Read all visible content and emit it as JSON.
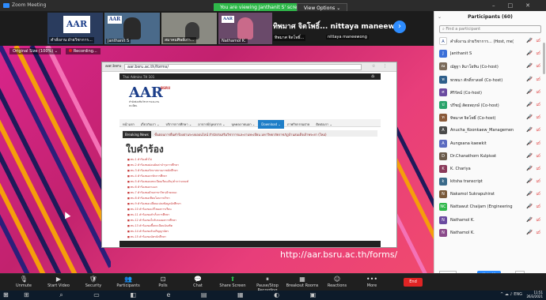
{
  "window": {
    "title": "Zoom Meeting"
  },
  "share_banner": "You are viewing Janthanit S' screen",
  "view_options": "View Options ⌄",
  "thumbnails": [
    {
      "name": "คำสั่งงาน ฝ่ายวิชาการ..."
    },
    {
      "name": "Janthanit S"
    },
    {
      "name": "สมาคมศิษย์เก่า..."
    },
    {
      "name": "Nathamol K."
    },
    {
      "name": "ทิพมาศ จิตโพธิ์..."
    },
    {
      "name": "nittaya maneewong"
    }
  ],
  "presenter_text": "ทิพมาศ จิตโพธิ์... nittaya maneew...",
  "share_toolbar": {
    "original_size": "Original Size (100%) ⌄",
    "recording": "Recording..."
  },
  "browser": {
    "tab": "aar.bsru",
    "url": "aar.bsru.ac.th/forms/"
  },
  "site": {
    "topbar": "Thai Admins TH 101",
    "logo": {
      "main": "AAR",
      "badge": "BSRU",
      "sub": "สำนักส่งเสริมวิชาการและงานทะเบียน"
    },
    "nav": [
      "หน้าแรก",
      "เกี่ยวกับเรา ⌄",
      "บริการการศึกษา ⌄",
      "อาจารย์/บุคลากร ⌄",
      "บุคคลภายนอก ⌄",
      "Download ⌄",
      "ภาพกิจกรรมฝ่าย",
      "ติดต่อเรา ⌄"
    ],
    "ticker_label": "Breaking News",
    "ticker_text": "ขั้นตอนการยื่นคำร้องผ่านระบบออนไลน์ สำนักส่งเสริมวิชาการและงานทะเบียน มหาวิทยาลัยราชภัฏบ้านสมเด็จเจ้าพระยา (ใหม่)",
    "heading": "ใบคำร้อง",
    "forms": [
      "ทบ.1 คำร้องทั่วไป",
      "ทบ.2 คำร้องขอผ่อนผันค่าบำรุงการศึกษา",
      "ทบ.3 คำร้องขอรักษาสถานภาพนักศึกษา",
      "ทบ.4 คำร้องขอลาพักการศึกษา",
      "ทบ.5 คำร้องขอลงทะเบียนเรียนเกิน/ต่ำกว่าเกณฑ์",
      "ทบ.6 คำร้องขอลาออก",
      "ทบ.7 คำร้องขอย้ายสาขาวิชา/ย้ายคณะ",
      "ทบ.8 คำร้องขอเทียบโอนรายวิชา",
      "ทบ.9 คำร้องขอเปลี่ยนแปลงข้อมูลนักศึกษา",
      "ทบ.10 คำร้องขอแก้ไขผลการเรียน",
      "ทบ.11 คำร้องขอสำเร็จการศึกษา",
      "ทบ.12 คำร้องขอใบรับรองผลการศึกษา",
      "ทบ.13 คำร้องขอขึ้นทะเบียนบัณฑิต",
      "ทบ.14 คำร้องขอรับปริญญาบัตร",
      "ทบ.15 คำร้องขอบัตรนักศึกษา",
      "ทบ.16 คำร้องขอคืนเงินค่าธรรมเนียม",
      "ทบ.17 คำร้องขอลงทะเบียนเรียนเพิ่ม/ถอน"
    ]
  },
  "url_caption": "http://aar.bsru.ac.th/forms/",
  "toolbar": [
    {
      "name": "unmute",
      "label": "Unmute",
      "icon": "🎙"
    },
    {
      "name": "start-video",
      "label": "Start Video",
      "icon": "▶"
    },
    {
      "name": "security",
      "label": "Security",
      "icon": "🛡"
    },
    {
      "name": "participants",
      "label": "Participants",
      "icon": "👥"
    },
    {
      "name": "polls",
      "label": "Polls",
      "icon": "⊡"
    },
    {
      "name": "chat",
      "label": "Chat",
      "icon": "💬"
    },
    {
      "name": "share-screen",
      "label": "Share Screen",
      "icon": "⬆"
    },
    {
      "name": "pause-recording",
      "label": "Pause/Stop Recording",
      "icon": "⏸"
    },
    {
      "name": "breakout-rooms",
      "label": "Breakout Rooms",
      "icon": "▦"
    },
    {
      "name": "reactions",
      "label": "Reactions",
      "icon": "☺"
    },
    {
      "name": "more",
      "label": "More",
      "icon": "•••"
    }
  ],
  "end_label": "End",
  "participants_panel": {
    "title": "Participants (60)",
    "search_placeholder": "Find a participant",
    "people": [
      {
        "name": "คำสั่งงาน ฝ่ายวิชาการ... (Host, me)",
        "initial": "A",
        "color": "#ffffff"
      },
      {
        "name": "Janthanit S",
        "initial": "J",
        "color": "#3b6fd8"
      },
      {
        "name": "ณัฐฐา ลิมาโยทิน (Co-host)",
        "initial": "ณ",
        "color": "#7a6a5a"
      },
      {
        "name": "พรพนา ศักดิ์ทาสงค์ (Co-host)",
        "initial": "พ",
        "color": "#2f5f8a"
      },
      {
        "name": "ศิริรัตน์ (Co-host)",
        "initial": "ศ",
        "color": "#6a4aa0"
      },
      {
        "name": "ปรีชญ์ สัตยพฤกษ์ (Co-host)",
        "initial": "ป",
        "color": "#2aa36b"
      },
      {
        "name": "ทิพมาศ จิตโพธิ์ (Co-host)",
        "initial": "ท",
        "color": "#8a5a3a"
      },
      {
        "name": "Anucha_Koonkaew_Management",
        "initial": "A",
        "color": "#4a4a4a"
      },
      {
        "name": "Aungsana kaewkit",
        "initial": "A",
        "color": "#5c6bc0"
      },
      {
        "name": "Dr.Chanathorn Kulpivat",
        "initial": "D",
        "color": "#6a5a4a"
      },
      {
        "name": "K. Chariya",
        "initial": "K",
        "color": "#8a3a5a"
      },
      {
        "name": "kitsha transcript",
        "initial": "k",
        "color": "#3a6a8a"
      },
      {
        "name": "Nakamol Sukrapuhirat",
        "initial": "N",
        "color": "#7a5a3a"
      },
      {
        "name": "Nattawut Chaijam (Engineering and...)",
        "initial": "NC",
        "color": "#2fb84a"
      },
      {
        "name": "Nathamol K.",
        "initial": "N",
        "color": "#6a4aa0"
      },
      {
        "name": "Nathamol K.",
        "initial": "N",
        "color": "#8a4a8a"
      }
    ],
    "invite": "Invite",
    "mute_all": "Mute All",
    "more": "..."
  },
  "taskbar": {
    "apps": "⊞ ⌕ ▭ ◧ e ▤ ▦ ◐ ▣",
    "tray": "^ ☁ ♪ ENG",
    "time": "11:51",
    "date": "26/3/2021"
  }
}
